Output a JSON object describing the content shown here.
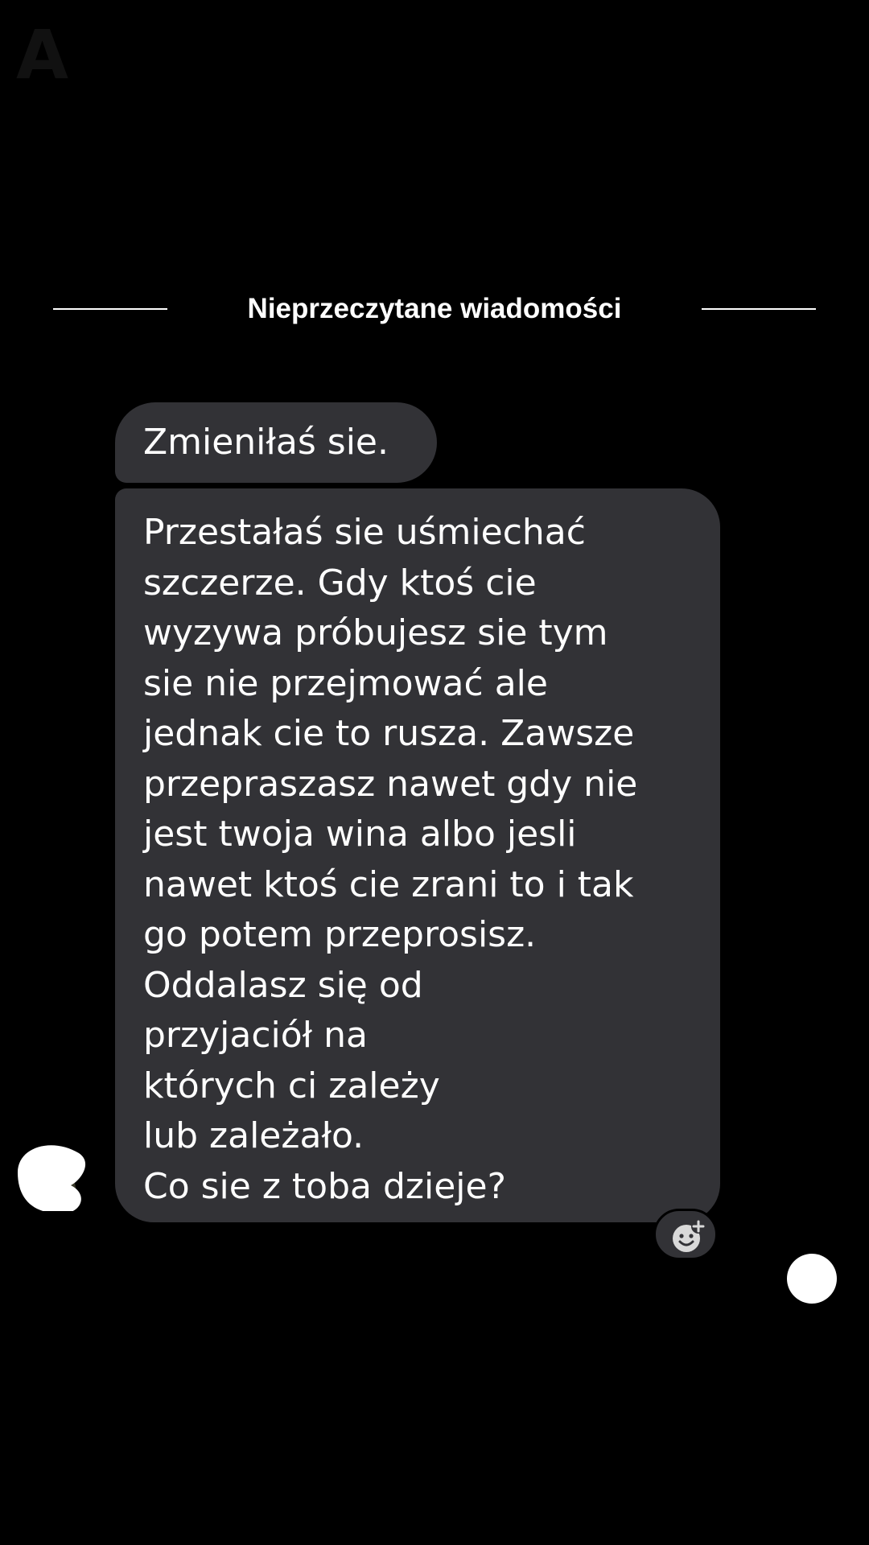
{
  "corner_mark": "A",
  "divider": {
    "label": "Nieprzeczytane wiadomości"
  },
  "messages": [
    {
      "sender": "other",
      "text": "Zmieniłaś sie."
    },
    {
      "sender": "other",
      "text": "Przestałaś sie uśmiechać\nszczerze. Gdy ktoś cie\nwyzywa próbujesz sie tym\nsie nie przejmować ale\njednak cie to rusza. Zawsze\nprzepraszasz nawet gdy nie\njest twoja wina albo jesli\nnawet ktoś cie zrani to i tak\ngo potem przeprosisz.\nOddalasz się od\nprzyjaciół na\nktórych ci zależy\nlub zależało.\nCo sie z toba dzieje?"
    }
  ],
  "icons": {
    "avatar": "avatar-blob-icon",
    "reaction": "add-reaction-smiley-icon",
    "scroll": "scroll-down-dot-icon"
  },
  "colors": {
    "background": "#000000",
    "bubble": "#323236",
    "text": "#ffffff"
  }
}
